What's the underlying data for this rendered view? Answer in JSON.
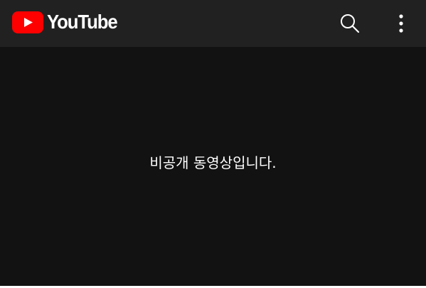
{
  "header": {
    "logo_text": "YouTube",
    "logo_icon": "youtube-play-logo-icon",
    "search_icon": "search-icon",
    "menu_icon": "more-vert-icon"
  },
  "player": {
    "message": "비공개 동영상입니다."
  },
  "colors": {
    "header_bg": "#212121",
    "page_bg": "#121212",
    "brand_red": "#ff0000",
    "text": "#ffffff"
  }
}
